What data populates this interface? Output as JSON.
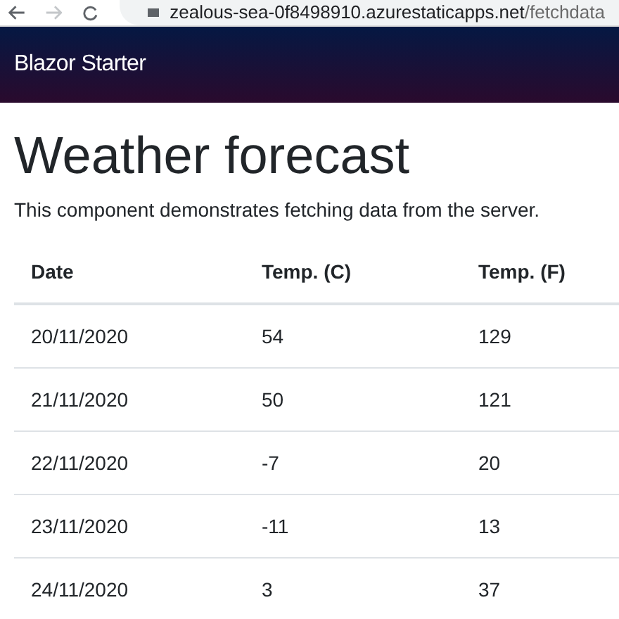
{
  "browser": {
    "address_host": "zealous-sea-0f8498910.azurestaticapps.net",
    "address_path": "/fetchdata"
  },
  "navbar": {
    "brand": "Blazor Starter"
  },
  "page": {
    "title": "Weather forecast",
    "description": "This component demonstrates fetching data from the server."
  },
  "table": {
    "columns": [
      "Date",
      "Temp. (C)",
      "Temp. (F)"
    ],
    "rows": [
      [
        "20/11/2020",
        "54",
        "129"
      ],
      [
        "21/11/2020",
        "50",
        "121"
      ],
      [
        "22/11/2020",
        "-7",
        "20"
      ],
      [
        "23/11/2020",
        "-11",
        "13"
      ],
      [
        "24/11/2020",
        "3",
        "37"
      ]
    ]
  }
}
